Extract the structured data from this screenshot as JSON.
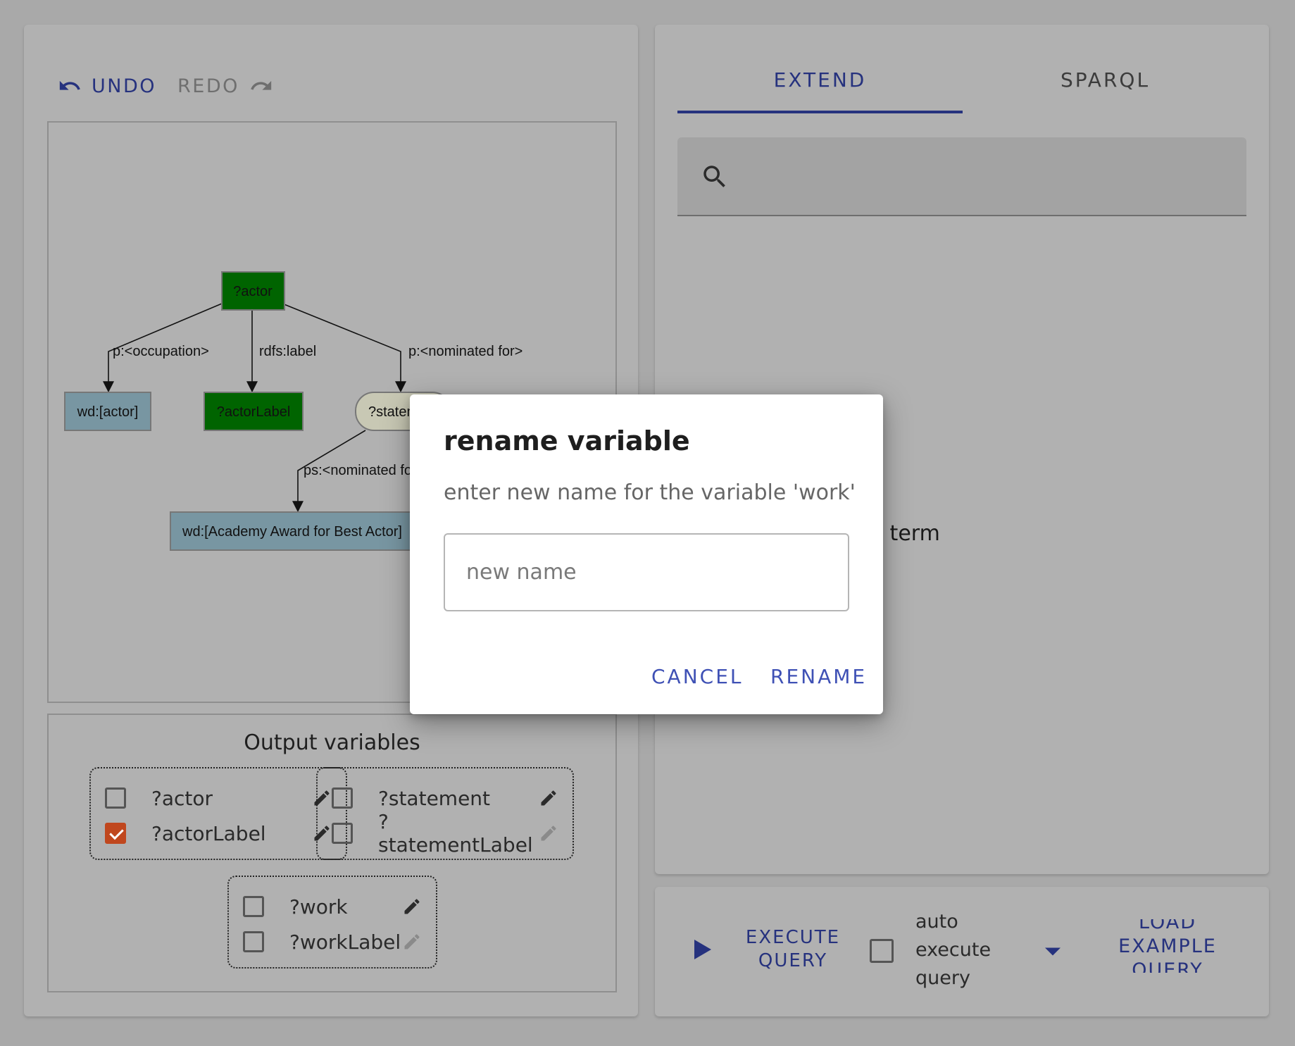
{
  "toolbar": {
    "undo_label": "UNDO",
    "redo_label": "REDO"
  },
  "graph": {
    "nodes": {
      "actor": "?actor",
      "wd_actor": "wd:[actor]",
      "actor_label": "?actorLabel",
      "statement": "?statement",
      "award": "wd:[Academy Award for Best Actor]"
    },
    "edges": {
      "occupation": "p:<occupation>",
      "label": "rdfs:label",
      "nominated_for": "p:<nominated for>",
      "ps_nominated_for": "ps:<nominated for>"
    },
    "colors": {
      "variable_node": "#006400",
      "entity_node": "#7896a2",
      "statement_node": "#c8c8b4"
    }
  },
  "output": {
    "title": "Output variables",
    "groups": [
      {
        "vars": [
          {
            "name": "?actor",
            "checked": false
          },
          {
            "name": "?actorLabel",
            "checked": true
          }
        ]
      },
      {
        "vars": [
          {
            "name": "?statement",
            "checked": false
          },
          {
            "name": "?statementLabel",
            "checked": false
          }
        ]
      },
      {
        "vars": [
          {
            "name": "?work",
            "checked": false
          },
          {
            "name": "?workLabel",
            "checked": false
          }
        ]
      }
    ]
  },
  "tabs": {
    "extend": "EXTEND",
    "sparql": "SPARQL"
  },
  "search": {
    "placeholder": "",
    "empty_message": "Please enter a search term"
  },
  "bottom": {
    "execute_label": "EXECUTE QUERY",
    "auto_execute_label": "auto execute query",
    "load_example_label": "LOAD EXAMPLE QUERY"
  },
  "dialog": {
    "title": "rename variable",
    "text": "enter new name for the variable 'work'",
    "input_placeholder": "new name",
    "input_value": "",
    "cancel_label": "CANCEL",
    "rename_label": "RENAME"
  },
  "colors": {
    "accent": "#3f51b5",
    "accent_dark": "#26327e",
    "checked": "#c0471e",
    "overlay_bg": "#a9a9a9"
  },
  "icons": [
    "undo-icon",
    "redo-icon",
    "search-icon",
    "pencil-icon",
    "play-icon",
    "dropdown-arrow-icon"
  ]
}
